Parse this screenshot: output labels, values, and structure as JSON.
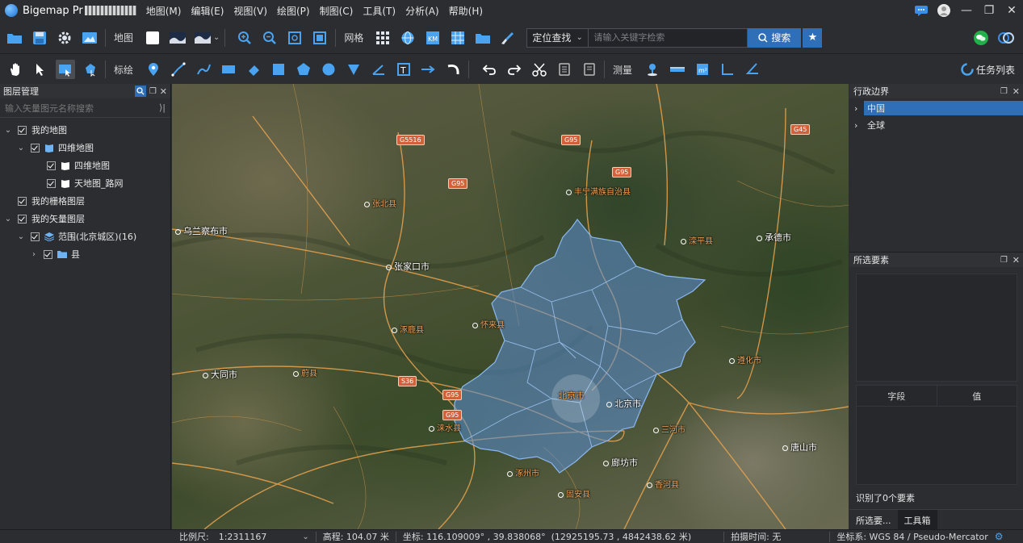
{
  "app": {
    "title": "Bigemap Pr"
  },
  "menu": [
    "地图(M)",
    "编辑(E)",
    "视图(V)",
    "绘图(P)",
    "制图(C)",
    "工具(T)",
    "分析(A)",
    "帮助(H)"
  ],
  "toolbar1": {
    "map_label": "地图",
    "grid_label": "网格",
    "locate_label": "定位查找",
    "search_placeholder": "请输入关键字检索",
    "search_button": "搜索"
  },
  "toolbar2": {
    "mark_label": "标绘",
    "measure_label": "测量",
    "task_list": "任务列表"
  },
  "left_panel": {
    "title": "图层管理",
    "search_placeholder": "输入矢量图元名称搜索",
    "tree": [
      {
        "label": "我的地图"
      },
      {
        "label": "四维地图"
      },
      {
        "label": "四维地图"
      },
      {
        "label": "天地图_路网"
      },
      {
        "label": "我的栅格图层"
      },
      {
        "label": "我的矢量图层"
      },
      {
        "label": "范围(北京城区)(16)"
      },
      {
        "label": "县"
      }
    ]
  },
  "map": {
    "places": [
      {
        "name": "乌兰察布市"
      },
      {
        "name": "张家口市"
      },
      {
        "name": "承德市"
      },
      {
        "name": "大同市"
      },
      {
        "name": "北京市"
      },
      {
        "name": "廊坊市"
      },
      {
        "name": "唐山市"
      },
      {
        "name": "北京市"
      },
      {
        "name": "张北县"
      },
      {
        "name": "丰宁满族自治县"
      },
      {
        "name": "滦平县"
      },
      {
        "name": "怀来县"
      },
      {
        "name": "涿鹿县"
      },
      {
        "name": "蔚县"
      },
      {
        "name": "涞水县"
      },
      {
        "name": "遵化市"
      },
      {
        "name": "三河市"
      },
      {
        "name": "香河县"
      },
      {
        "name": "涿州市"
      },
      {
        "name": "固安县"
      }
    ],
    "highways": [
      "G5516",
      "G95",
      "G95",
      "G95",
      "G95",
      "G95",
      "S36",
      "G45"
    ]
  },
  "right_panel": {
    "admin_title": "行政边界",
    "admin_items": [
      "中国",
      "全球"
    ],
    "selected_title": "所选要素",
    "field_header": "字段",
    "value_header": "值",
    "identified": "识别了0个要素",
    "tabs": [
      "所选要...",
      "工具箱"
    ]
  },
  "status": {
    "scale_label": "比例尺:",
    "scale_value": "1:2311167",
    "elevation": "高程: 104.07 米",
    "coords": "坐标: 116.109009° , 39.838068°  (12925195.73 , 4842438.62 米)",
    "capture_time": "拍摄时间: 无",
    "crs": "坐标系: WGS 84 / Pseudo-Mercator"
  },
  "colors": {
    "accent": "#2f6fb8",
    "region_fill": "#5b8fd6",
    "panel_bg": "#2b2d31"
  }
}
